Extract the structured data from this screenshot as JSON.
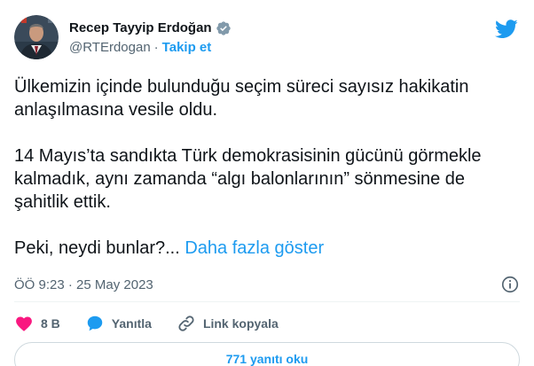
{
  "author": {
    "name": "Recep Tayyip Erdoğan",
    "handle": "@RTErdogan",
    "separator": "·",
    "follow_label": "Takip et"
  },
  "tweet": {
    "paragraphs": [
      "Ülkemizin içinde bulunduğu seçim süreci sayısız hakikatin anlaşılmasına vesile oldu.",
      "14 Mayıs’ta sandıkta Türk demokrasisinin gücünü görmekle kalmadık, aynı zamanda “algı balonlarının” sönmesine de şahitlik ettik."
    ],
    "last_line": "Peki, neydi bunlar?...",
    "show_more_label": "Daha fazla göster"
  },
  "meta": {
    "timestamp": "ÖÖ 9:23 · 25 May 2023"
  },
  "actions": {
    "like_count": "8 B",
    "reply_label": "Yanıtla",
    "copy_link_label": "Link kopyala"
  },
  "replies_button_label": "771 yanıtı oku",
  "colors": {
    "accent": "#1d9bf0",
    "like": "#f91880",
    "text_secondary": "#536471"
  },
  "icons": [
    "verified-badge-icon",
    "twitter-bird-icon",
    "info-icon",
    "heart-icon",
    "reply-bubble-icon",
    "link-icon"
  ]
}
